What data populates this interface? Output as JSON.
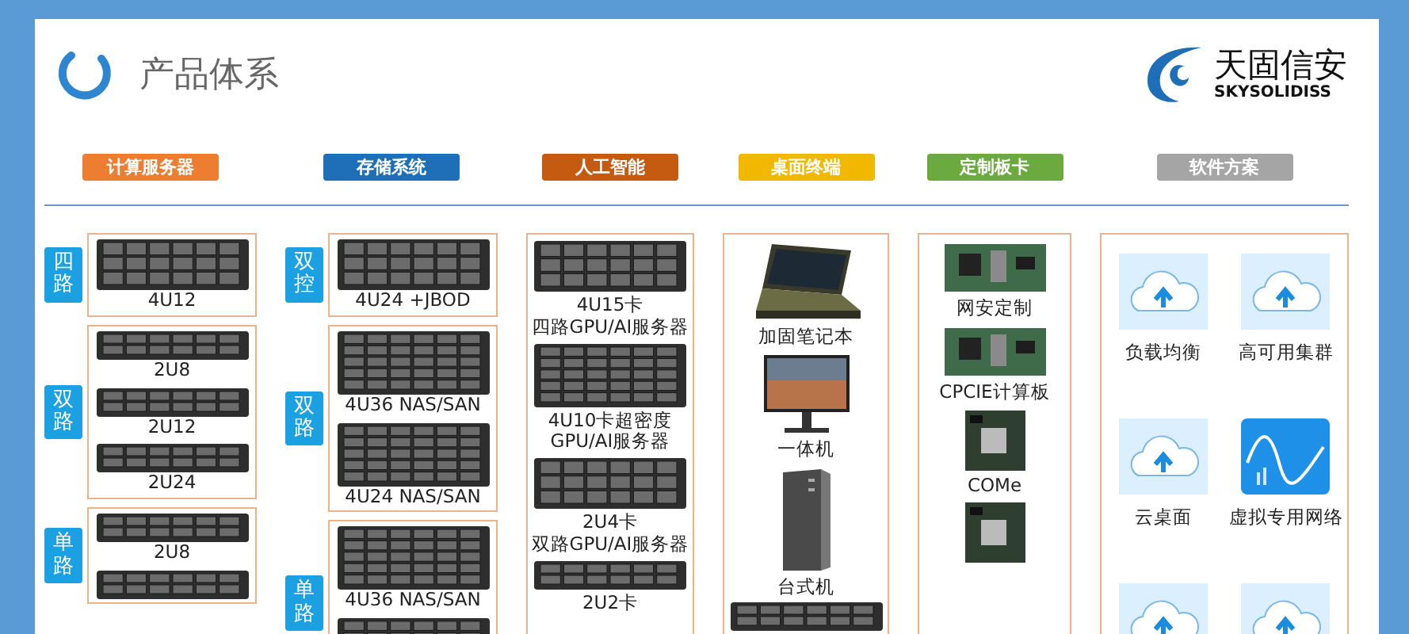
{
  "header": {
    "title": "产品体系",
    "logo": {
      "name": "天固信安",
      "tagline": "SKYSOLIDISS"
    }
  },
  "categories": [
    {
      "label": "计算服务器",
      "color": "#ed7d31"
    },
    {
      "label": "存储系统",
      "color": "#1f6fb8"
    },
    {
      "label": "人工智能",
      "color": "#c55a11"
    },
    {
      "label": "桌面终端",
      "color": "#f2b800"
    },
    {
      "label": "定制板卡",
      "color": "#6aaa3e"
    },
    {
      "label": "软件方案",
      "color": "#a5a5a5"
    }
  ],
  "columns": [
    {
      "kind": "grouped",
      "groups": [
        {
          "tag": "四路",
          "items": [
            {
              "kind": "server4u",
              "label": "4U12"
            }
          ]
        },
        {
          "tag": "双路",
          "items": [
            {
              "kind": "server2u",
              "label": "2U8"
            },
            {
              "kind": "server2u",
              "label": "2U12"
            },
            {
              "kind": "server2u",
              "label": "2U24"
            }
          ]
        },
        {
          "tag": "单路",
          "items": [
            {
              "kind": "server2u",
              "label": "2U8"
            },
            {
              "kind": "server2u"
            }
          ]
        }
      ]
    },
    {
      "kind": "grouped",
      "groups": [
        {
          "tag": "双控",
          "items": [
            {
              "kind": "server4u",
              "label": "4U24 +JBOD"
            }
          ]
        },
        {
          "tag": "双路",
          "items": [
            {
              "kind": "storage",
              "label": "4U36 NAS/SAN"
            },
            {
              "kind": "storage",
              "label": "4U24 NAS/SAN"
            }
          ]
        },
        {
          "tag": "单路",
          "items": [
            {
              "kind": "storage",
              "label": "4U36 NAS/SAN"
            },
            {
              "kind": "storage"
            }
          ]
        }
      ]
    },
    {
      "kind": "list",
      "items": [
        {
          "kind": "server4u",
          "lines": [
            "4U15卡",
            "四路GPU/AI服务器"
          ]
        },
        {
          "kind": "storage",
          "lines": [
            "4U10卡超密度",
            "GPU/AI服务器"
          ]
        },
        {
          "kind": "server4u",
          "lines": [
            "2U4卡",
            "双路GPU/AI服务器"
          ]
        },
        {
          "kind": "server2u",
          "label": "2U2卡"
        }
      ]
    },
    {
      "kind": "list",
      "items": [
        {
          "kind": "laptop",
          "label": "加固笔记本"
        },
        {
          "kind": "monitor",
          "label": "一体机"
        },
        {
          "kind": "tower",
          "label": "台式机"
        },
        {
          "kind": "server2u"
        }
      ]
    },
    {
      "kind": "list",
      "items": [
        {
          "kind": "board",
          "label": "网安定制"
        },
        {
          "kind": "board",
          "label": "CPCIE计算板"
        },
        {
          "kind": "module",
          "label": "COMe"
        },
        {
          "kind": "module"
        }
      ]
    },
    {
      "kind": "grid",
      "items": [
        {
          "kind": "cloud",
          "label": "负载均衡"
        },
        {
          "kind": "cloud",
          "label": "高可用集群"
        },
        {
          "kind": "cloud",
          "label": "云桌面"
        },
        {
          "kind": "wave",
          "label": "虚拟专用网络"
        },
        {
          "kind": "cloud"
        },
        {
          "kind": "cloud"
        }
      ]
    }
  ]
}
